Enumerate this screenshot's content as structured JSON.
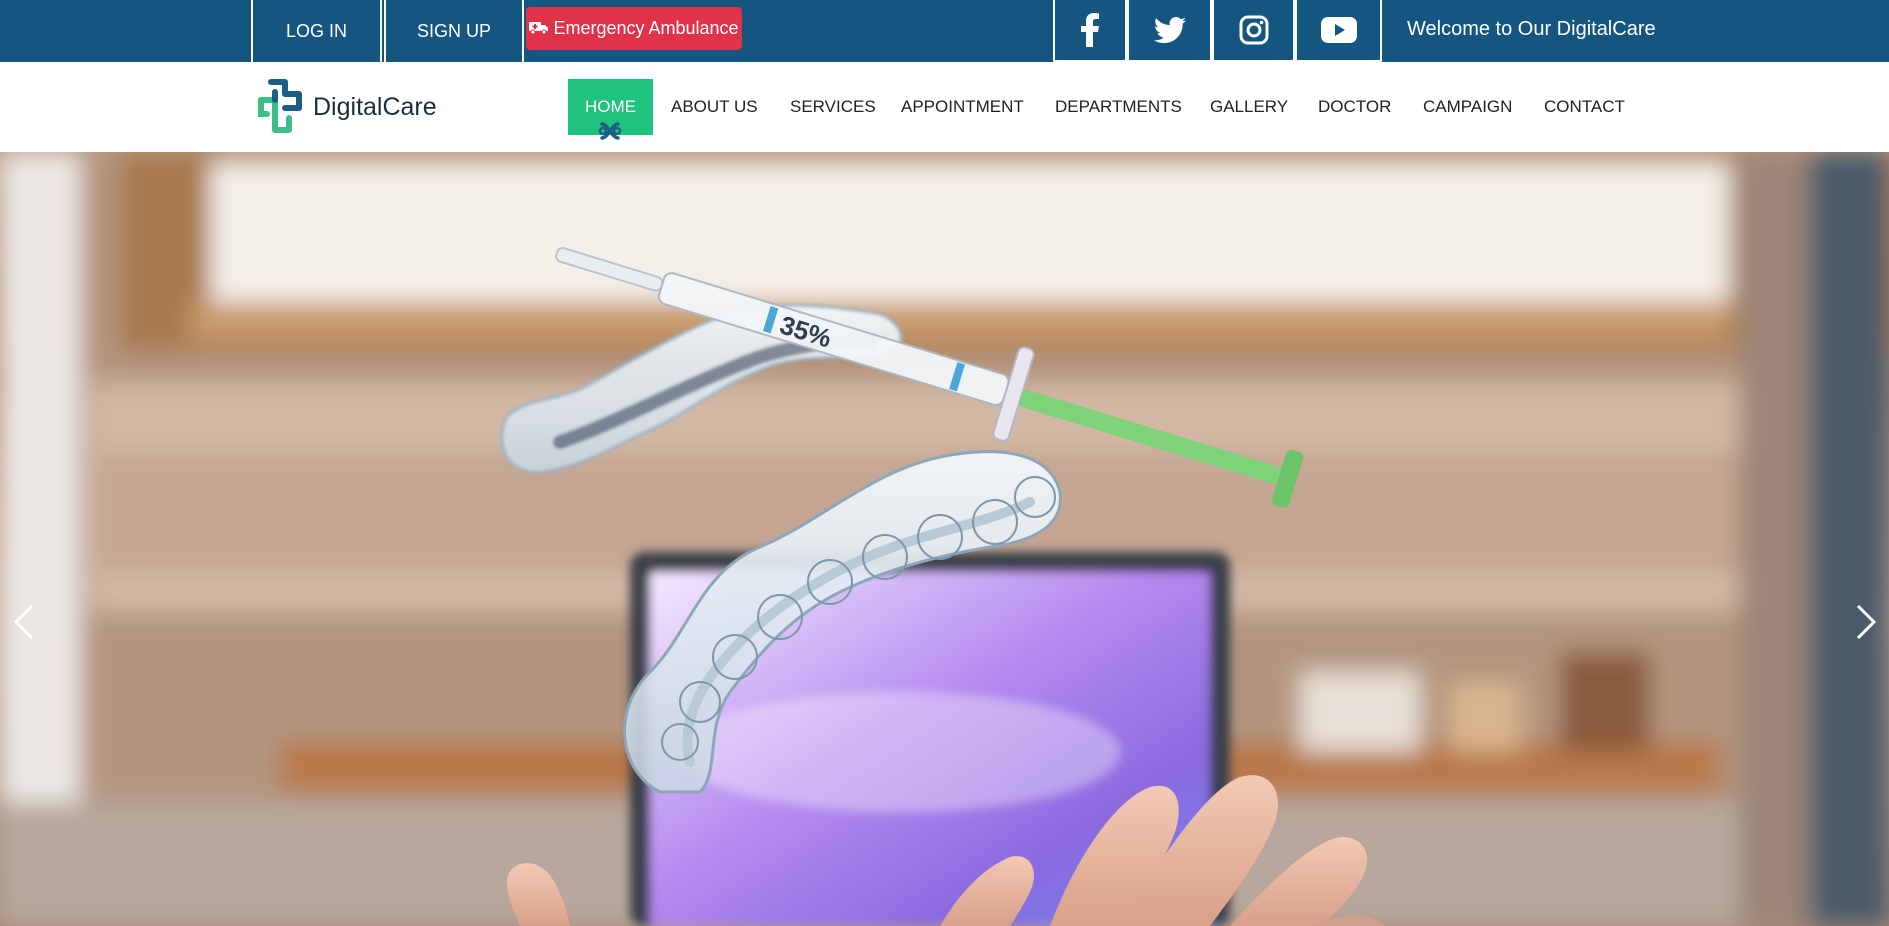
{
  "topbar": {
    "login_label": "LOG IN",
    "signup_label": "SIGN UP",
    "emergency_label": "Emergency Ambulance",
    "emergency_icon": "ambulance-icon",
    "social": [
      "facebook-icon",
      "twitter-icon",
      "instagram-icon",
      "youtube-icon"
    ],
    "welcome_text": "Welcome to Our DigitalCare"
  },
  "navbar": {
    "logo_text": "DigitalCare",
    "items": [
      {
        "label": "HOME",
        "active": true
      },
      {
        "label": "ABOUT US"
      },
      {
        "label": "SERVICES"
      },
      {
        "label": "APPOINTMENT"
      },
      {
        "label": "DEPARTMENTS"
      },
      {
        "label": "GALLERY"
      },
      {
        "label": "DOCTOR"
      },
      {
        "label": "CAMPAIGN"
      },
      {
        "label": "CONTACT"
      }
    ]
  },
  "hero": {
    "syringe_label": "35%",
    "prev_icon": "chevron-left-icon",
    "next_icon": "chevron-right-icon"
  },
  "colors": {
    "topbar_bg": "#14567f",
    "emergency_bg": "#e0334a",
    "active_nav_bg": "#1fc37e",
    "logo_green": "#3cbf86",
    "logo_blue": "#1c5f86"
  }
}
